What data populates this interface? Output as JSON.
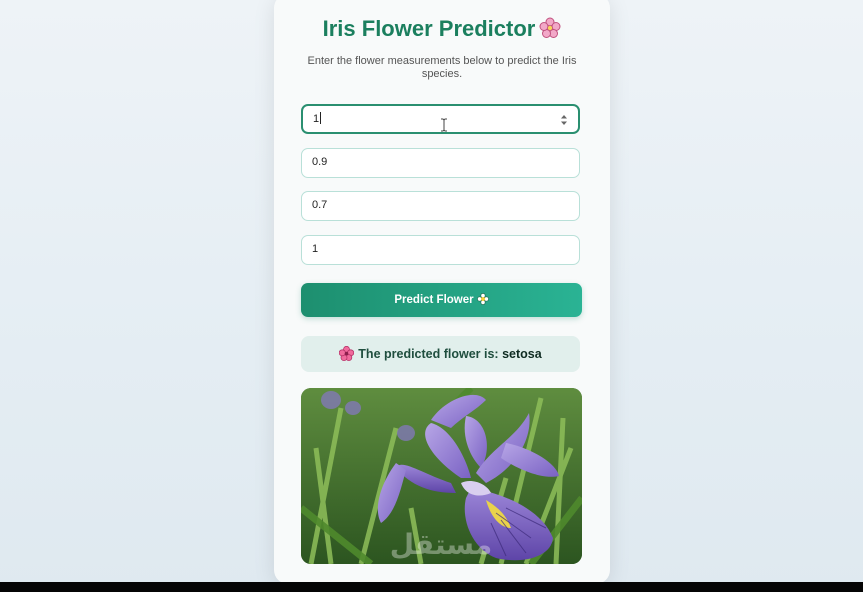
{
  "app": {
    "title": "Iris Flower Predictor",
    "title_icon": "cherry-blossom-icon",
    "subtitle": "Enter the flower measurements below to predict the Iris species."
  },
  "form": {
    "fields": [
      {
        "value": "1",
        "focused": true
      },
      {
        "value": "0.9"
      },
      {
        "value": "0.7"
      },
      {
        "value": "1"
      }
    ],
    "submit_label": "Predict Flower",
    "submit_icon": "blossom-icon"
  },
  "result": {
    "icon": "hibiscus-icon",
    "prefix": "The predicted flower is:",
    "species": "setosa"
  },
  "image": {
    "subject": "iris-flower-photo"
  },
  "watermark": {
    "text": "مستقل"
  },
  "colors": {
    "title": "#1b7f5e",
    "button_start": "#1d8f6f",
    "button_end": "#2ab394",
    "result_bg": "#e1efec",
    "focus_border": "#2a8f70"
  }
}
